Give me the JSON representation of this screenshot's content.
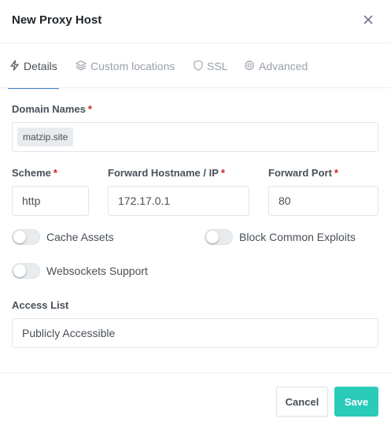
{
  "modal": {
    "title": "New Proxy Host"
  },
  "tabs": [
    {
      "label": "Details",
      "icon": "lightning-icon",
      "active": true
    },
    {
      "label": "Custom locations",
      "icon": "layers-icon"
    },
    {
      "label": "SSL",
      "icon": "shield-icon"
    },
    {
      "label": "Advanced",
      "icon": "gear-icon"
    }
  ],
  "form": {
    "domain_names": {
      "label": "Domain Names",
      "required": "*",
      "tags": [
        "matzip.site"
      ]
    },
    "scheme": {
      "label": "Scheme",
      "required": "*",
      "value": "http"
    },
    "forward_host": {
      "label": "Forward Hostname / IP",
      "required": "*",
      "value": "172.17.0.1"
    },
    "forward_port": {
      "label": "Forward Port",
      "required": "*",
      "value": "80"
    },
    "toggles": {
      "cache_assets": {
        "label": "Cache Assets",
        "on": false
      },
      "block_exploits": {
        "label": "Block Common Exploits",
        "on": false
      },
      "websockets": {
        "label": "Websockets Support",
        "on": false
      }
    },
    "access_list": {
      "label": "Access List",
      "value": "Publicly Accessible"
    }
  },
  "footer": {
    "cancel_label": "Cancel",
    "save_label": "Save"
  },
  "colors": {
    "accent": "#467fcf",
    "save": "#2bcbba",
    "required": "#cd201f"
  }
}
